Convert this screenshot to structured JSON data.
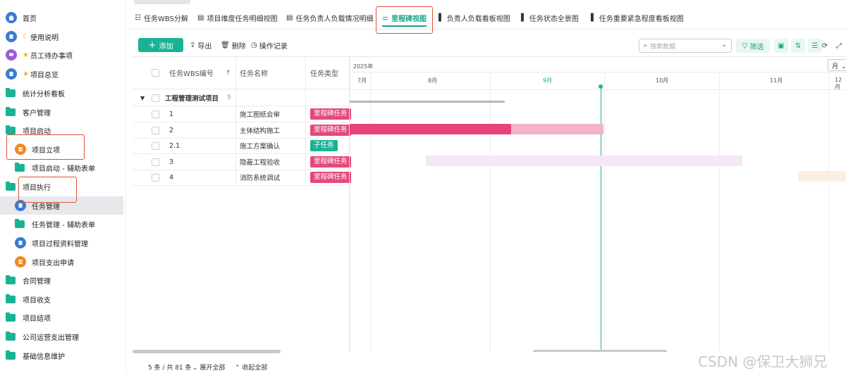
{
  "sidebar": {
    "items": [
      {
        "label": "首页",
        "icon": "home-icon",
        "color": "#3a7bd5"
      },
      {
        "label": "使用说明",
        "icon": "doc-icon",
        "color": "#3a7bd5",
        "prefix": "moon"
      },
      {
        "label": "员工待办事项",
        "icon": "chat-icon",
        "color": "#a05bd5",
        "prefix": "star"
      },
      {
        "label": "项目总览",
        "icon": "doc-icon",
        "color": "#3a7bd5",
        "prefix": "star"
      },
      {
        "label": "统计分析看板",
        "icon": "folder-icon"
      },
      {
        "label": "客户管理",
        "icon": "folder-icon"
      },
      {
        "label": "项目启动",
        "icon": "folder-icon"
      },
      {
        "label": "项目立项",
        "icon": "form-icon",
        "color": "#f08a24"
      },
      {
        "label": "项目启动 - 辅助表单",
        "icon": "folder-icon"
      },
      {
        "label": "项目执行",
        "icon": "folder-icon"
      },
      {
        "label": "任务管理",
        "icon": "doc-icon",
        "color": "#3a7bd5"
      },
      {
        "label": "任务管理 - 辅助表单",
        "icon": "folder-icon"
      },
      {
        "label": "项目过程资料管理",
        "icon": "doc-icon",
        "color": "#3a7bd5"
      },
      {
        "label": "项目支出申请",
        "icon": "form-icon",
        "color": "#f08a24"
      },
      {
        "label": "合同管理",
        "icon": "folder-icon"
      },
      {
        "label": "项目收支",
        "icon": "folder-icon"
      },
      {
        "label": "项目结项",
        "icon": "folder-icon"
      },
      {
        "label": "公司运营支出管理",
        "icon": "folder-icon"
      },
      {
        "label": "基础信息维护",
        "icon": "folder-icon"
      }
    ]
  },
  "tabs": [
    {
      "label": "任务WBS分解",
      "icon": "wbs-icon"
    },
    {
      "label": "项目维度任务明细视图",
      "icon": "table-icon"
    },
    {
      "label": "任务负责人负载情况明细",
      "icon": "table-icon"
    },
    {
      "label": "里程碑视图",
      "icon": "gantt-icon",
      "active": true
    },
    {
      "label": "负责人负载看板视图",
      "icon": "kanban-icon"
    },
    {
      "label": "任务状态全景图",
      "icon": "kanban-icon"
    },
    {
      "label": "任务重要紧急程度看板视图",
      "icon": "kanban-icon"
    }
  ],
  "toolbar": {
    "add": "添加",
    "export": "导出",
    "delete": "删除",
    "log": "操作记录",
    "search_placeholder": "搜索数据",
    "filter": "筛选"
  },
  "grid": {
    "headers": {
      "wbs": "任务WBS编号",
      "name": "任务名称",
      "type": "任务类型"
    },
    "group": {
      "name": "工程管理测试项目",
      "count": "5"
    },
    "rows": [
      {
        "wbs": "1",
        "name": "施工图纸会审",
        "type": "里程碑任务"
      },
      {
        "wbs": "2",
        "name": "主体结构施工",
        "type": "里程碑任务"
      },
      {
        "wbs": "2.1",
        "name": "施工方案确认",
        "type": "子任务"
      },
      {
        "wbs": "3",
        "name": "隐蔽工程验收",
        "type": "里程碑任务"
      },
      {
        "wbs": "4",
        "name": "消防系统调试",
        "type": "里程碑任务"
      }
    ]
  },
  "gantt": {
    "year": "2025年",
    "months": [
      "7月",
      "8月",
      "9月",
      "10月",
      "11月",
      "12月"
    ],
    "scale": "月"
  },
  "footer": {
    "count": "5 条 / 共 81 条",
    "expand": "展开全部",
    "collapse": "收起全部"
  },
  "watermark": "CSDN @保卫大狮兄",
  "colors": {
    "accent": "#19b394",
    "milestone": "#e34a7a",
    "highlight_box": "#e0503a"
  }
}
